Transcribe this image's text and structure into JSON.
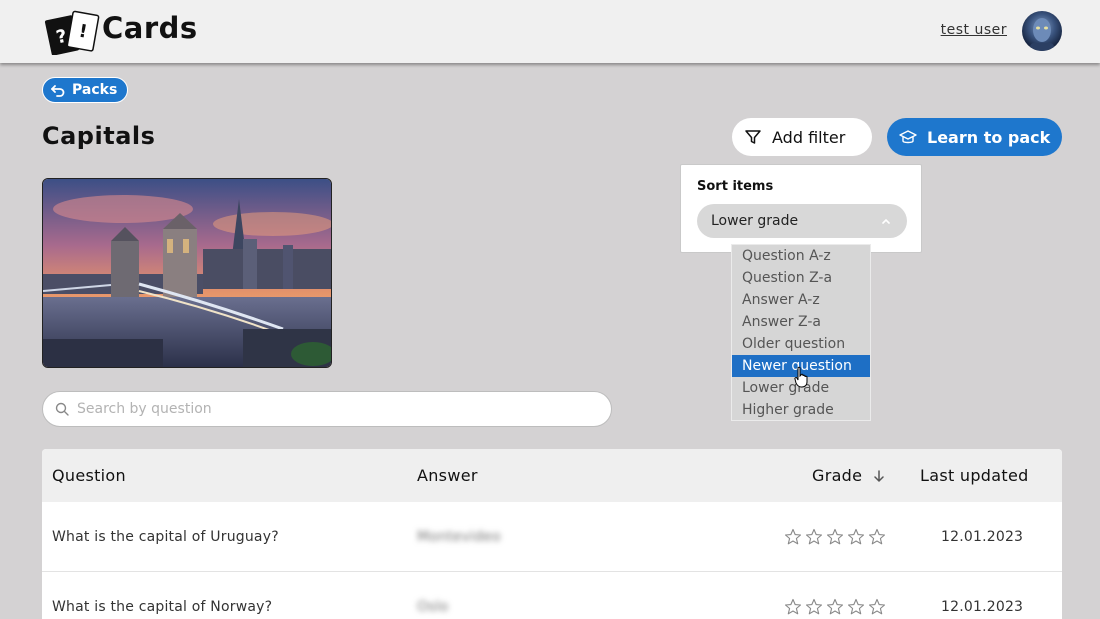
{
  "header": {
    "app_title": "Cards",
    "user_name": "test user"
  },
  "nav": {
    "back_label": "Packs"
  },
  "pack": {
    "title": "Capitals",
    "add_filter_label": "Add filter",
    "learn_label": "Learn to pack"
  },
  "search": {
    "placeholder": "Search by question"
  },
  "sort": {
    "label": "Sort items",
    "selected": "Lower grade",
    "options": [
      "Question A-z",
      "Question Z-a",
      "Answer A-z",
      "Answer Z-a",
      "Older question",
      "Newer question",
      "Lower grade",
      "Higher grade"
    ],
    "highlighted_option": "Newer question"
  },
  "table": {
    "headers": {
      "question": "Question",
      "answer": "Answer",
      "grade": "Grade",
      "last_updated": "Last updated"
    },
    "rows": [
      {
        "question": "What is the capital of Uruguay?",
        "answer": "Montevideo",
        "grade": 0,
        "last_updated": "12.01.2023"
      },
      {
        "question": "What is the capital of Norway?",
        "answer": "Oslo",
        "grade": 0,
        "last_updated": "12.01.2023"
      }
    ]
  },
  "colors": {
    "accent": "#1e77cd",
    "background": "#d4d2d3",
    "highlight": "#1e6fc5"
  },
  "icons": {
    "logo": "cards-logo-icon",
    "back": "back-arrow-icon",
    "filter": "filter-icon",
    "learn": "graduation-cap-icon",
    "search": "search-icon",
    "sort": "arrow-down-icon",
    "star": "star-icon"
  }
}
